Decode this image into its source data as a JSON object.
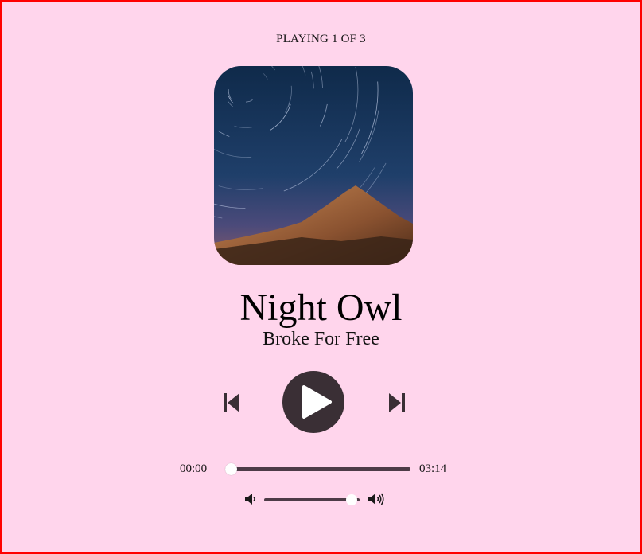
{
  "player": {
    "counter_text": "PLAYING 1 OF 3",
    "track_title": "Night Owl",
    "artist": "Broke For Free",
    "current_time": "00:00",
    "duration": "03:14",
    "progress_fraction": 0.0,
    "volume_fraction": 0.92
  },
  "icons": {
    "prev": "skip-previous-icon",
    "play": "play-icon",
    "next": "skip-next-icon",
    "volume_low": "volume-low-icon",
    "volume_high": "volume-high-icon"
  },
  "colors": {
    "background": "#ffd5ec",
    "controls": "#3a2f35",
    "track": "#4d3b47",
    "thumb": "#ffffff"
  }
}
